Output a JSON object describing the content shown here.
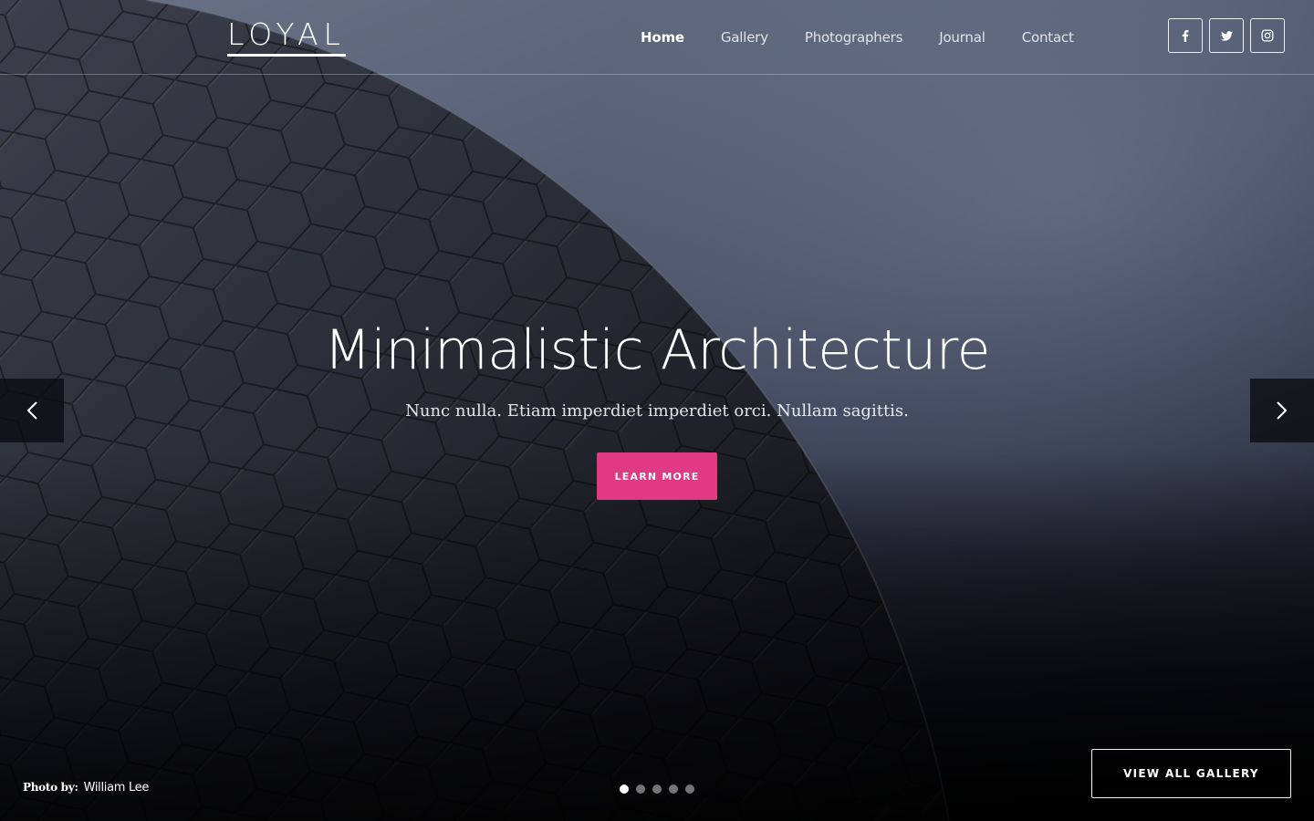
{
  "brand": {
    "logo": "LOYAL"
  },
  "nav": {
    "items": [
      {
        "label": "Home",
        "active": true
      },
      {
        "label": "Gallery",
        "active": false
      },
      {
        "label": "Photographers",
        "active": false
      },
      {
        "label": "Journal",
        "active": false
      },
      {
        "label": "Contact",
        "active": false
      }
    ]
  },
  "social": [
    {
      "icon": "facebook-icon"
    },
    {
      "icon": "twitter-icon"
    },
    {
      "icon": "instagram-icon"
    }
  ],
  "slide": {
    "title": "Minimalistic Architecture",
    "subtitle": "Nunc nulla. Etiam imperdiet imperdiet orci. Nullam sagittis.",
    "cta_label": "LEARN MORE",
    "accent_color": "#e03a84"
  },
  "slider": {
    "prev_icon": "chevron-left-icon",
    "next_icon": "chevron-right-icon",
    "dot_count": 5,
    "active_index": 0
  },
  "credit": {
    "label": "Photo by:",
    "name": "William Lee"
  },
  "gallery_button": {
    "label": "VIEW ALL GALLERY"
  }
}
